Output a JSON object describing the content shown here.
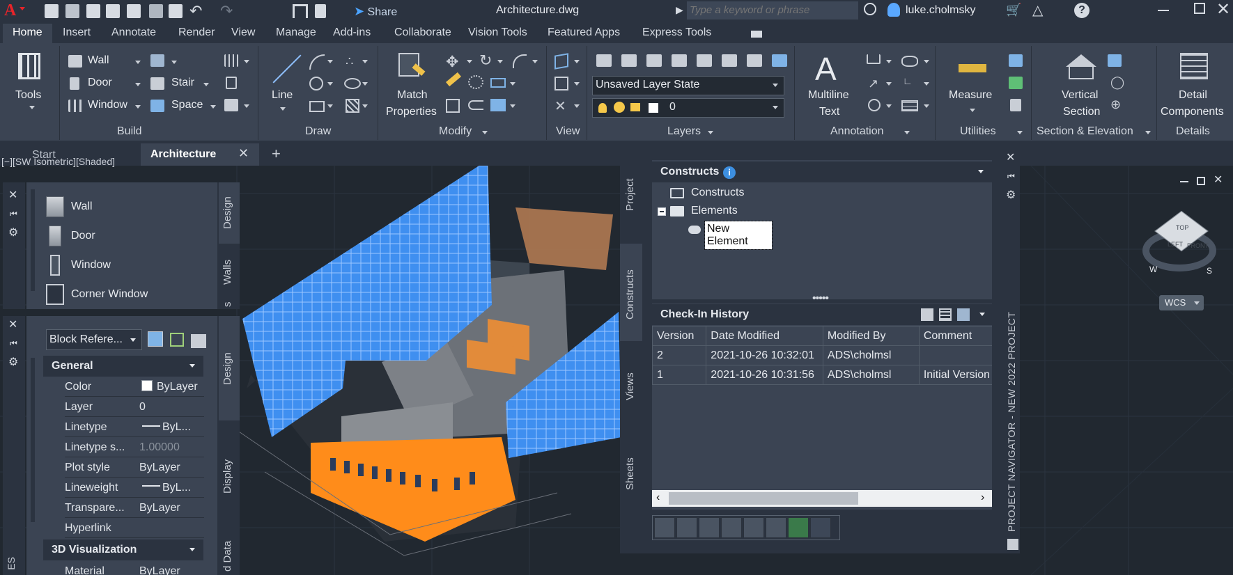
{
  "title_bar": {
    "app_menu": "A",
    "share_label": "Share",
    "file_title": "Architecture.dwg",
    "search_placeholder": "Type a keyword or phrase",
    "user_name": "luke.cholmsky",
    "help_icon": "question-icon"
  },
  "ribbon_tabs": [
    "Home",
    "Insert",
    "Annotate",
    "Render",
    "View",
    "Manage",
    "Add-ins",
    "Collaborate",
    "Vision Tools",
    "Featured Apps",
    "Express Tools"
  ],
  "ribbon": {
    "tools_label": "Tools",
    "build": {
      "wall": "Wall",
      "door": "Door",
      "window": "Window",
      "stair": "Stair",
      "space": "Space",
      "group": "Build"
    },
    "draw": {
      "line": "Line",
      "group": "Draw"
    },
    "modify": {
      "match": "Match",
      "properties": "Properties",
      "group": "Modify"
    },
    "view": {
      "group": "View"
    },
    "layers": {
      "layer_state": "Unsaved Layer State",
      "layer_value": "0",
      "group": "Layers"
    },
    "annotation": {
      "multiline": "Multiline",
      "text": "Text",
      "group": "Annotation"
    },
    "utilities": {
      "measure": "Measure",
      "group": "Utilities"
    },
    "section": {
      "vertical": "Vertical",
      "section": "Section",
      "group": "Section & Elevation"
    },
    "details": {
      "detail": "Detail",
      "components": "Components",
      "group": "Details"
    }
  },
  "doc_tabs": {
    "start": "Start",
    "active": "Architecture",
    "close": "✕",
    "add": "+"
  },
  "viewport_label": "[−][SW Isometric][Shaded]",
  "tool_palette": {
    "items": [
      "Wall",
      "Door",
      "Window",
      "Corner Window"
    ],
    "tabs": [
      "Design",
      "Walls",
      "s"
    ]
  },
  "properties": {
    "selection": "Block Refere...",
    "general_header": "General",
    "rows": [
      {
        "label": "Color",
        "value": "ByLayer"
      },
      {
        "label": "Layer",
        "value": "0"
      },
      {
        "label": "Linetype",
        "value": "ByL..."
      },
      {
        "label": "Linetype s...",
        "value": "1.00000"
      },
      {
        "label": "Plot style",
        "value": "ByLayer"
      },
      {
        "label": "Lineweight",
        "value": "ByL..."
      },
      {
        "label": "Transpare...",
        "value": "ByLayer"
      },
      {
        "label": "Hyperlink",
        "value": ""
      }
    ],
    "viz_header": "3D Visualization",
    "material_label": "Material",
    "material_value": "ByLayer",
    "tabs": [
      "Design",
      "Display",
      "d Data"
    ],
    "side_label": "ES"
  },
  "project_navigator": {
    "tabs": [
      "Project",
      "Constructs",
      "Views",
      "Sheets"
    ],
    "constructs_header": "Constructs",
    "tree": [
      "Constructs",
      "Elements",
      "New Element"
    ],
    "history_header": "Check-In History",
    "columns": [
      "Version",
      "Date Modified",
      "Modified By",
      "Comment"
    ],
    "rows": [
      {
        "version": "2",
        "date": "2021-10-26 10:32:01",
        "by": "ADS\\cholmsl",
        "comment": ""
      },
      {
        "version": "1",
        "date": "2021-10-26 10:31:56",
        "by": "ADS\\cholmsl",
        "comment": "Initial Version"
      }
    ],
    "side_title": "PROJECT NAVIGATOR - NEW 2022 PROJECT"
  },
  "viewcube": {
    "top": "TOP",
    "left": "LEFT",
    "front": "FRONT",
    "w": "W",
    "s": "S",
    "wcs": "WCS"
  },
  "colors": {
    "curtain_wall": "#3f8ff0",
    "base_floor": "#ff8c1a",
    "accent": "#0096d6"
  }
}
